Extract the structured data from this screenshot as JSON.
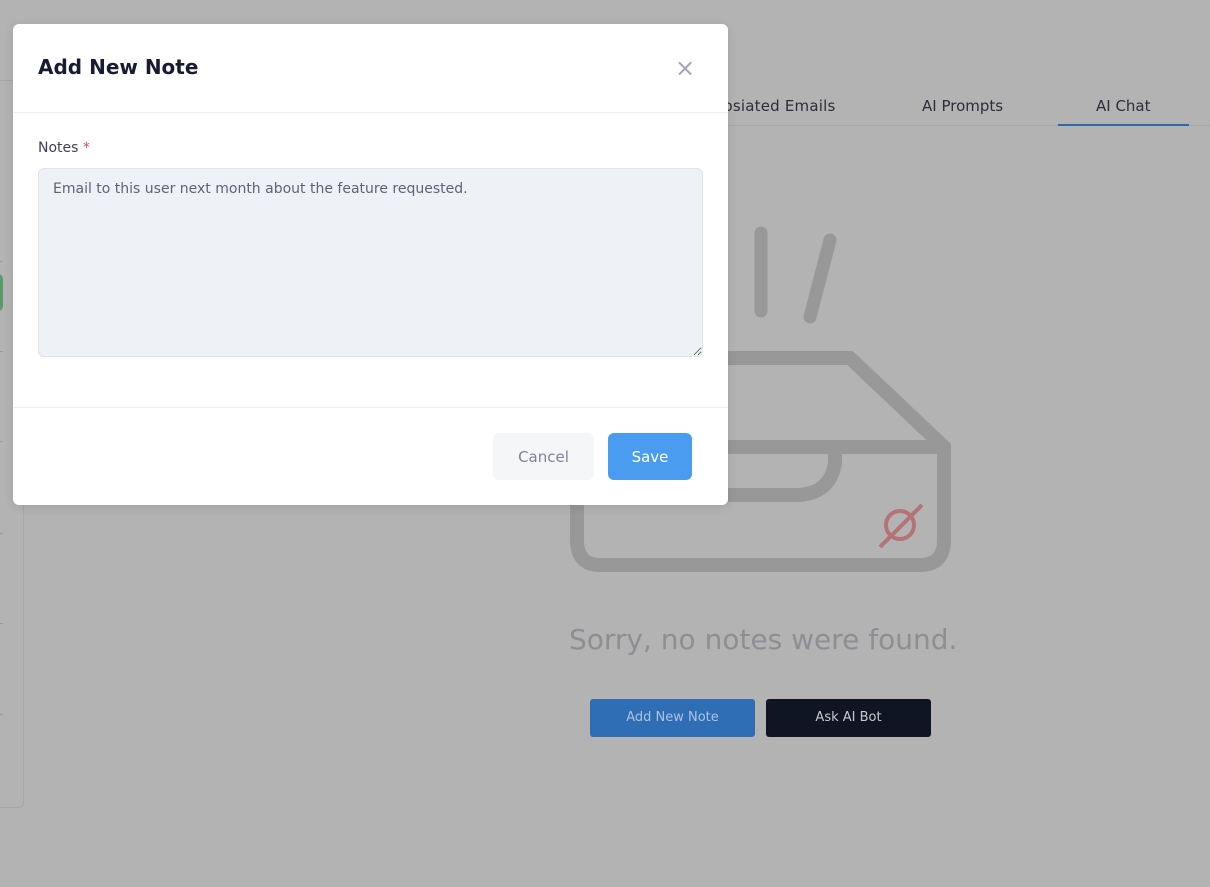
{
  "background": {
    "tabs": [
      {
        "label": "Assosiated Emails"
      },
      {
        "label": "AI Prompts"
      },
      {
        "label": "AI Chat",
        "active": true
      }
    ],
    "empty_state": {
      "message": "Sorry, no notes were found.",
      "icon": "empty-inbox-icon"
    },
    "buttons": {
      "add_note": "Add New Note",
      "ask_bot": "Ask AI Bot"
    }
  },
  "modal": {
    "title": "Add New Note",
    "close_icon": "close-icon",
    "field_label": "Notes",
    "required_mark": "*",
    "notes_value": "Email to this user next month about the feature requested.",
    "cancel_label": "Cancel",
    "save_label": "Save"
  },
  "colors": {
    "accent": "#4a9cf0",
    "overlay": "#b3b3b3",
    "required": "#e04a64"
  }
}
